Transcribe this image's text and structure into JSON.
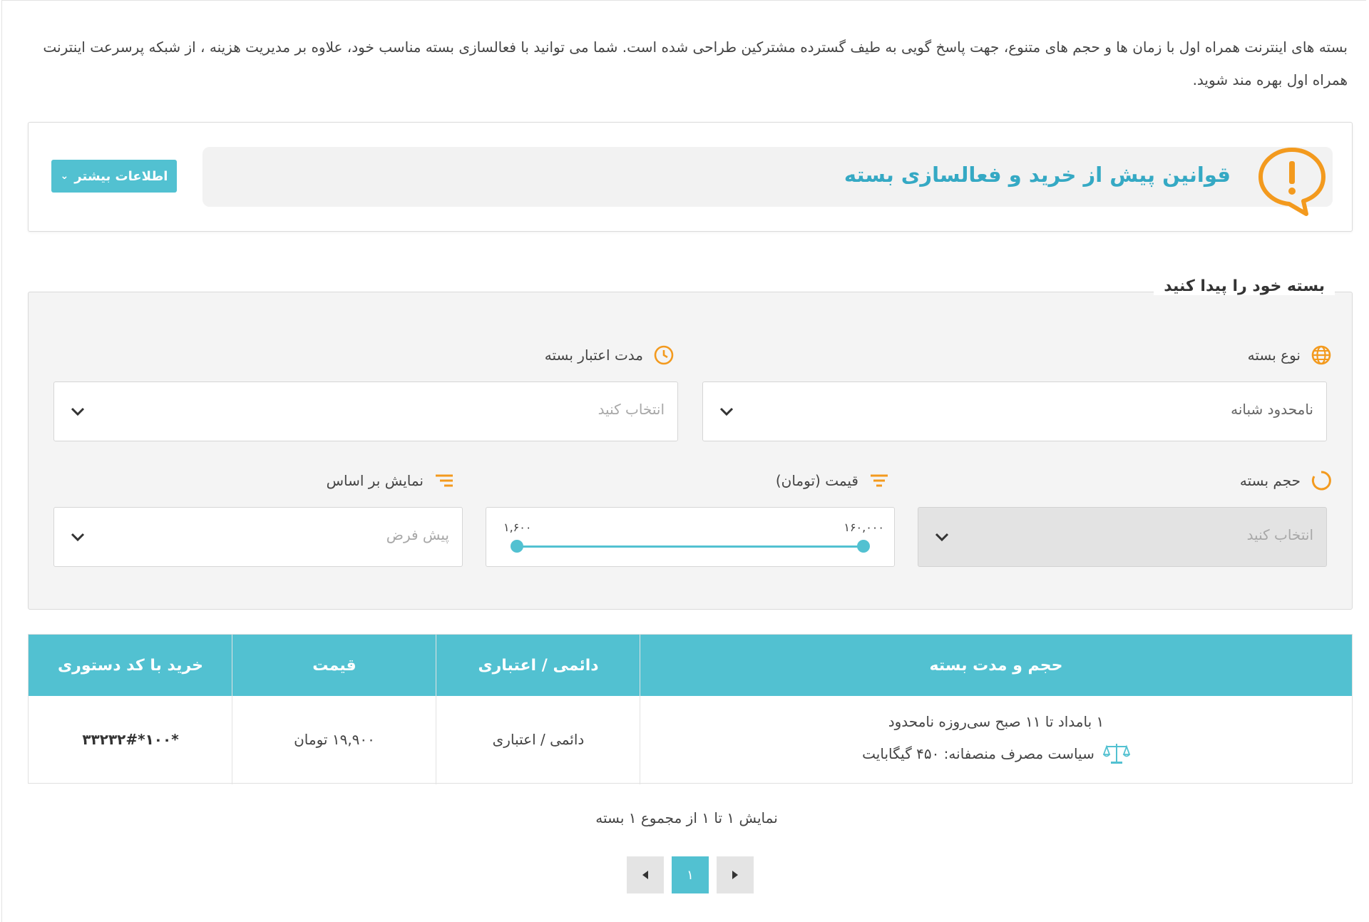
{
  "intro": {
    "text": "بسته های اینترنت همراه اول با زمان ها و حجم های متنوع، جهت پاسخ گویی به طیف گسترده مشترکین طراحی شده است. شما می توانید با فعالسازی بسته مناسب خود، علاوه بر مدیریت هزینه ، از شبکه پرسرعت اینترنت همراه اول بهره مند شوید."
  },
  "rules": {
    "title": "قوانین پیش از خرید و فعالسازی بسته",
    "more_button": "اطلاعات بیشتر",
    "icon": "alert-bubble-icon"
  },
  "filter": {
    "legend": "بسته خود را پیدا کنید",
    "package_type": {
      "label": "نوع بسته",
      "value": "نامحدود شبانه",
      "icon": "globe-icon"
    },
    "validity": {
      "label": "مدت اعتبار بسته",
      "placeholder": "انتخاب کنید",
      "icon": "clock-icon"
    },
    "volume": {
      "label": "حجم بسته",
      "placeholder": "انتخاب کنید",
      "icon": "circle-progress-icon"
    },
    "price": {
      "label": "قیمت (تومان)",
      "min": "۱,۶۰۰",
      "max": "۱۶۰,۰۰۰",
      "icon": "filter-icon"
    },
    "sort": {
      "label": "نمایش بر اساس",
      "placeholder": "پیش فرض",
      "icon": "sort-icon"
    }
  },
  "table": {
    "headers": {
      "package": "حجم و مدت بسته",
      "type": "دائمی / اعتباری",
      "price": "قیمت",
      "code": "خرید با کد دستوری"
    },
    "rows": [
      {
        "package": "۱ بامداد تا ۱۱ صبح سی‌روزه نامحدود",
        "policy": "سیاست مصرف منصفانه: ۴۵۰ گیگابایت",
        "type": "دائمی / اعتباری",
        "price": "۱۹,۹۰۰ تومان",
        "code": "*۱۰۰*۳۳۲۳۲#"
      }
    ]
  },
  "summary": "نمایش ۱ تا ۱ از مجموع ۱ بسته",
  "pagination": {
    "current": "۱",
    "prev_icon": "prev-arrow-icon",
    "next_icon": "next-arrow-icon"
  },
  "colors": {
    "accent": "#52c1d1",
    "title": "#35a9c4",
    "orange": "#f39a1e"
  }
}
